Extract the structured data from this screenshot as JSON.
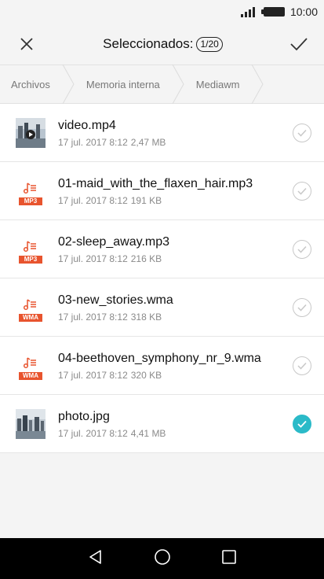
{
  "status": {
    "time": "10:00"
  },
  "header": {
    "title": "Seleccionados:",
    "counter": "1/20"
  },
  "breadcrumb": [
    "Archivos",
    "Memoria interna",
    "Mediawm"
  ],
  "files": [
    {
      "name": "video.mp4",
      "date": "17 jul. 2017 8:12",
      "size": "2,47 MB",
      "type": "video",
      "selected": false
    },
    {
      "name": "01-maid_with_the_flaxen_hair.mp3",
      "date": "17 jul. 2017 8:12",
      "size": "191 KB",
      "type": "audio",
      "badge": "MP3",
      "selected": false
    },
    {
      "name": "02-sleep_away.mp3",
      "date": "17 jul. 2017 8:12",
      "size": "216 KB",
      "type": "audio",
      "badge": "MP3",
      "selected": false
    },
    {
      "name": "03-new_stories.wma",
      "date": "17 jul. 2017 8:12",
      "size": "318 KB",
      "type": "audio",
      "badge": "WMA",
      "selected": false
    },
    {
      "name": "04-beethoven_symphony_nr_9.wma",
      "date": "17 jul. 2017 8:12",
      "size": "320 KB",
      "type": "audio",
      "badge": "WMA",
      "selected": false
    },
    {
      "name": "photo.jpg",
      "date": "17 jul. 2017 8:12",
      "size": "4,41 MB",
      "type": "image",
      "selected": true
    }
  ],
  "colors": {
    "accent": "#2bbac8",
    "audio_badge": "#e8542e"
  }
}
